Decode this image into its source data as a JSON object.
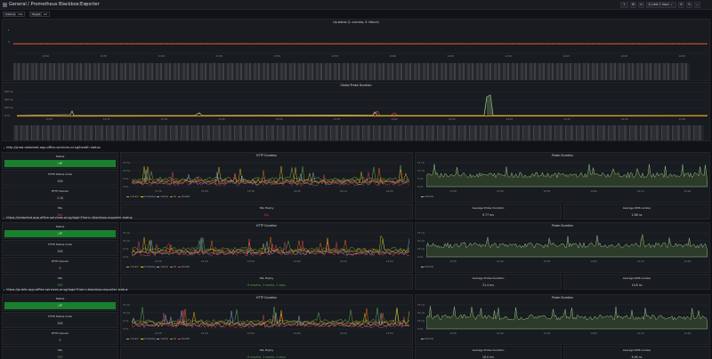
{
  "header": {
    "breadcrumb": "General / Prometheus Blackbox Exporter",
    "time_range": "Last 1 hour"
  },
  "variables": [
    {
      "label": "Interval",
      "value": "10s"
    },
    {
      "label": "Target",
      "value": "All"
    }
  ],
  "panels": {
    "up_status_title": "Up status (1: success, 0: failure)",
    "global_duration_title": "Global Probe Duration",
    "up_x_ticks": [
      "13:30",
      "13:35",
      "13:40",
      "13:45",
      "13:50",
      "13:55",
      "14:00",
      "14:05",
      "14:10",
      "14:15",
      "14:20",
      "14:25"
    ],
    "gpd_x_ticks": [
      "13:30",
      "13:35",
      "13:40",
      "13:45",
      "13:50",
      "13:55",
      "14:00",
      "14:05",
      "14:10",
      "14:15",
      "14:20",
      "14:25"
    ],
    "up_y_ticks": [
      "1",
      "0"
    ],
    "gpd_y_ticks": [
      "600 ms",
      "400 ms",
      "200 ms",
      "0 ms"
    ]
  },
  "sections": [
    {
      "title": "http://prod.redacted.app.office.services.or.sg/health status",
      "status_label": "Status",
      "status_value": "UP",
      "http_code_label": "HTTP Status Code",
      "http_code_value": "200",
      "http_version_label": "HTTP Version",
      "http_version_value": "1.10",
      "ssl_label": "SSL",
      "ssl_value": "N/A",
      "ssl_color": "#e02f44",
      "ssl_expiry_label": "SSL Expiry",
      "ssl_expiry_value": "N/A",
      "ssl_expiry_color": "#e02f44",
      "http_duration_title": "HTTP Duration",
      "probe_duration_title": "Probe Duration",
      "avg_probe_label": "Average Probe Duration",
      "avg_probe_value": "9.77 ms",
      "avg_dns_label": "Average DNS Lookup",
      "avg_dns_value": "2.98 ns",
      "http_y_ticks": [
        "15 ms",
        "10 ms",
        "5 ms",
        "0 ms"
      ],
      "probe_y_ticks": [
        "15 ms",
        "10 ms",
        "5 ms",
        "0 ms"
      ],
      "x_ticks": [
        "13:30",
        "13:40",
        "13:50",
        "14:00",
        "14:10",
        "14:20"
      ],
      "legend": [
        "connect",
        "processing",
        "resolve",
        "tls",
        "transfer"
      ],
      "probe_legend": "seconds"
    },
    {
      "title": "https://redacted.app.office.services.or.sg/login?from=blackbox-exporter status",
      "status_label": "Status",
      "status_value": "UP",
      "http_code_label": "HTTP Status Code",
      "http_code_value": "200",
      "http_version_label": "HTTP Version",
      "http_version_value": "2",
      "ssl_label": "SSL",
      "ssl_value": "YES",
      "ssl_color": "#56a64b",
      "ssl_expiry_label": "SSL Expiry",
      "ssl_expiry_value": "6 months, 3 weeks, 2 days",
      "ssl_expiry_color": "#56a64b",
      "http_duration_title": "HTTP Duration",
      "probe_duration_title": "Probe Duration",
      "avg_probe_label": "Average Probe Duration",
      "avg_probe_value": "31.4 ms",
      "avg_dns_label": "Average DNS Lookup",
      "avg_dns_value": "14.8 ns",
      "http_y_ticks": [
        "15 ms",
        "10 ms",
        "5 ms",
        "0 ms"
      ],
      "probe_y_ticks": [
        "75 ms",
        "50 ms",
        "25 ms",
        "0 ms"
      ],
      "x_ticks": [
        "13:30",
        "13:40",
        "13:50",
        "14:00",
        "14:10",
        "14:20"
      ],
      "legend": [
        "connect",
        "processing",
        "resolve",
        "tls",
        "transfer"
      ],
      "probe_legend": "seconds"
    },
    {
      "title": "https://public.app.office.services.or.sg/login?from=blackbox-exporter status",
      "status_label": "Status",
      "status_value": "UP",
      "http_code_label": "HTTP Status Code",
      "http_code_value": "200",
      "http_version_label": "HTTP Version",
      "http_version_value": "2",
      "ssl_label": "SSL",
      "ssl_value": "YES",
      "ssl_color": "#56a64b",
      "ssl_expiry_label": "SSL Expiry",
      "ssl_expiry_value": "6 months, 3 weeks, 2 days",
      "ssl_expiry_color": "#56a64b",
      "http_duration_title": "HTTP Duration",
      "probe_duration_title": "Probe Duration",
      "avg_probe_label": "Average Probe Duration",
      "avg_probe_value": "16.0 ms",
      "avg_dns_label": "Average DNS Lookup",
      "avg_dns_value": "6.46 ns",
      "http_y_ticks": [
        "15 ms",
        "10 ms",
        "5 ms",
        "0 ms"
      ],
      "probe_y_ticks": [
        "75 ms",
        "50 ms",
        "25 ms",
        "0 ms"
      ],
      "x_ticks": [
        "13:30",
        "13:40",
        "13:50",
        "14:00",
        "14:10",
        "14:20"
      ],
      "legend": [
        "connect",
        "processing",
        "resolve",
        "tls",
        "transfer"
      ],
      "probe_legend": "seconds"
    }
  ],
  "colors": {
    "up_green": "#1a7f2e",
    "series": [
      "#73bf69",
      "#f2cc0c",
      "#8ab8ff",
      "#ff780a",
      "#f2495c"
    ],
    "probe": "#9ac48a"
  },
  "icons": [
    "menu-icon",
    "star-icon",
    "share-icon",
    "clock-icon",
    "zoom-out-icon",
    "refresh-icon",
    "chevron-down-icon",
    "settings-icon",
    "tv-icon",
    "add-panel-icon"
  ]
}
